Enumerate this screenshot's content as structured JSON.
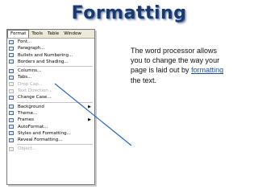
{
  "title": "Formatting",
  "menubar": [
    "Format",
    "Tools",
    "Table",
    "Window"
  ],
  "menu_items": [
    {
      "label": "Font...",
      "disabled": false,
      "submenu": false
    },
    {
      "label": "Paragraph...",
      "disabled": false,
      "submenu": false
    },
    {
      "label": "Bullets and Numbering...",
      "disabled": false,
      "submenu": false
    },
    {
      "label": "Borders and Shading...",
      "disabled": false,
      "submenu": false
    },
    {
      "sep": true
    },
    {
      "label": "Columns...",
      "disabled": false,
      "submenu": false
    },
    {
      "label": "Tabs...",
      "disabled": false,
      "submenu": false
    },
    {
      "label": "Drop Cap...",
      "disabled": true,
      "submenu": false
    },
    {
      "label": "Text Direction...",
      "disabled": true,
      "submenu": false
    },
    {
      "label": "Change Case...",
      "disabled": false,
      "submenu": false
    },
    {
      "sep": true
    },
    {
      "label": "Background",
      "disabled": false,
      "submenu": true
    },
    {
      "label": "Theme...",
      "disabled": false,
      "submenu": false
    },
    {
      "label": "Frames",
      "disabled": false,
      "submenu": true
    },
    {
      "label": "AutoFormat...",
      "disabled": false,
      "submenu": false
    },
    {
      "label": "Styles and Formatting...",
      "disabled": false,
      "submenu": false
    },
    {
      "label": "Reveal Formatting...",
      "disabled": false,
      "submenu": false
    },
    {
      "sep": true
    },
    {
      "label": "Object...",
      "disabled": true,
      "submenu": false
    }
  ],
  "description": {
    "before_link": "The word processor allows you to change the way your page is laid out by ",
    "link": "formatting",
    "after_link": " the text."
  },
  "colors": {
    "title": "#1a3a6e",
    "link": "#1a4d9e",
    "pointer_line": "#2a64c8"
  }
}
